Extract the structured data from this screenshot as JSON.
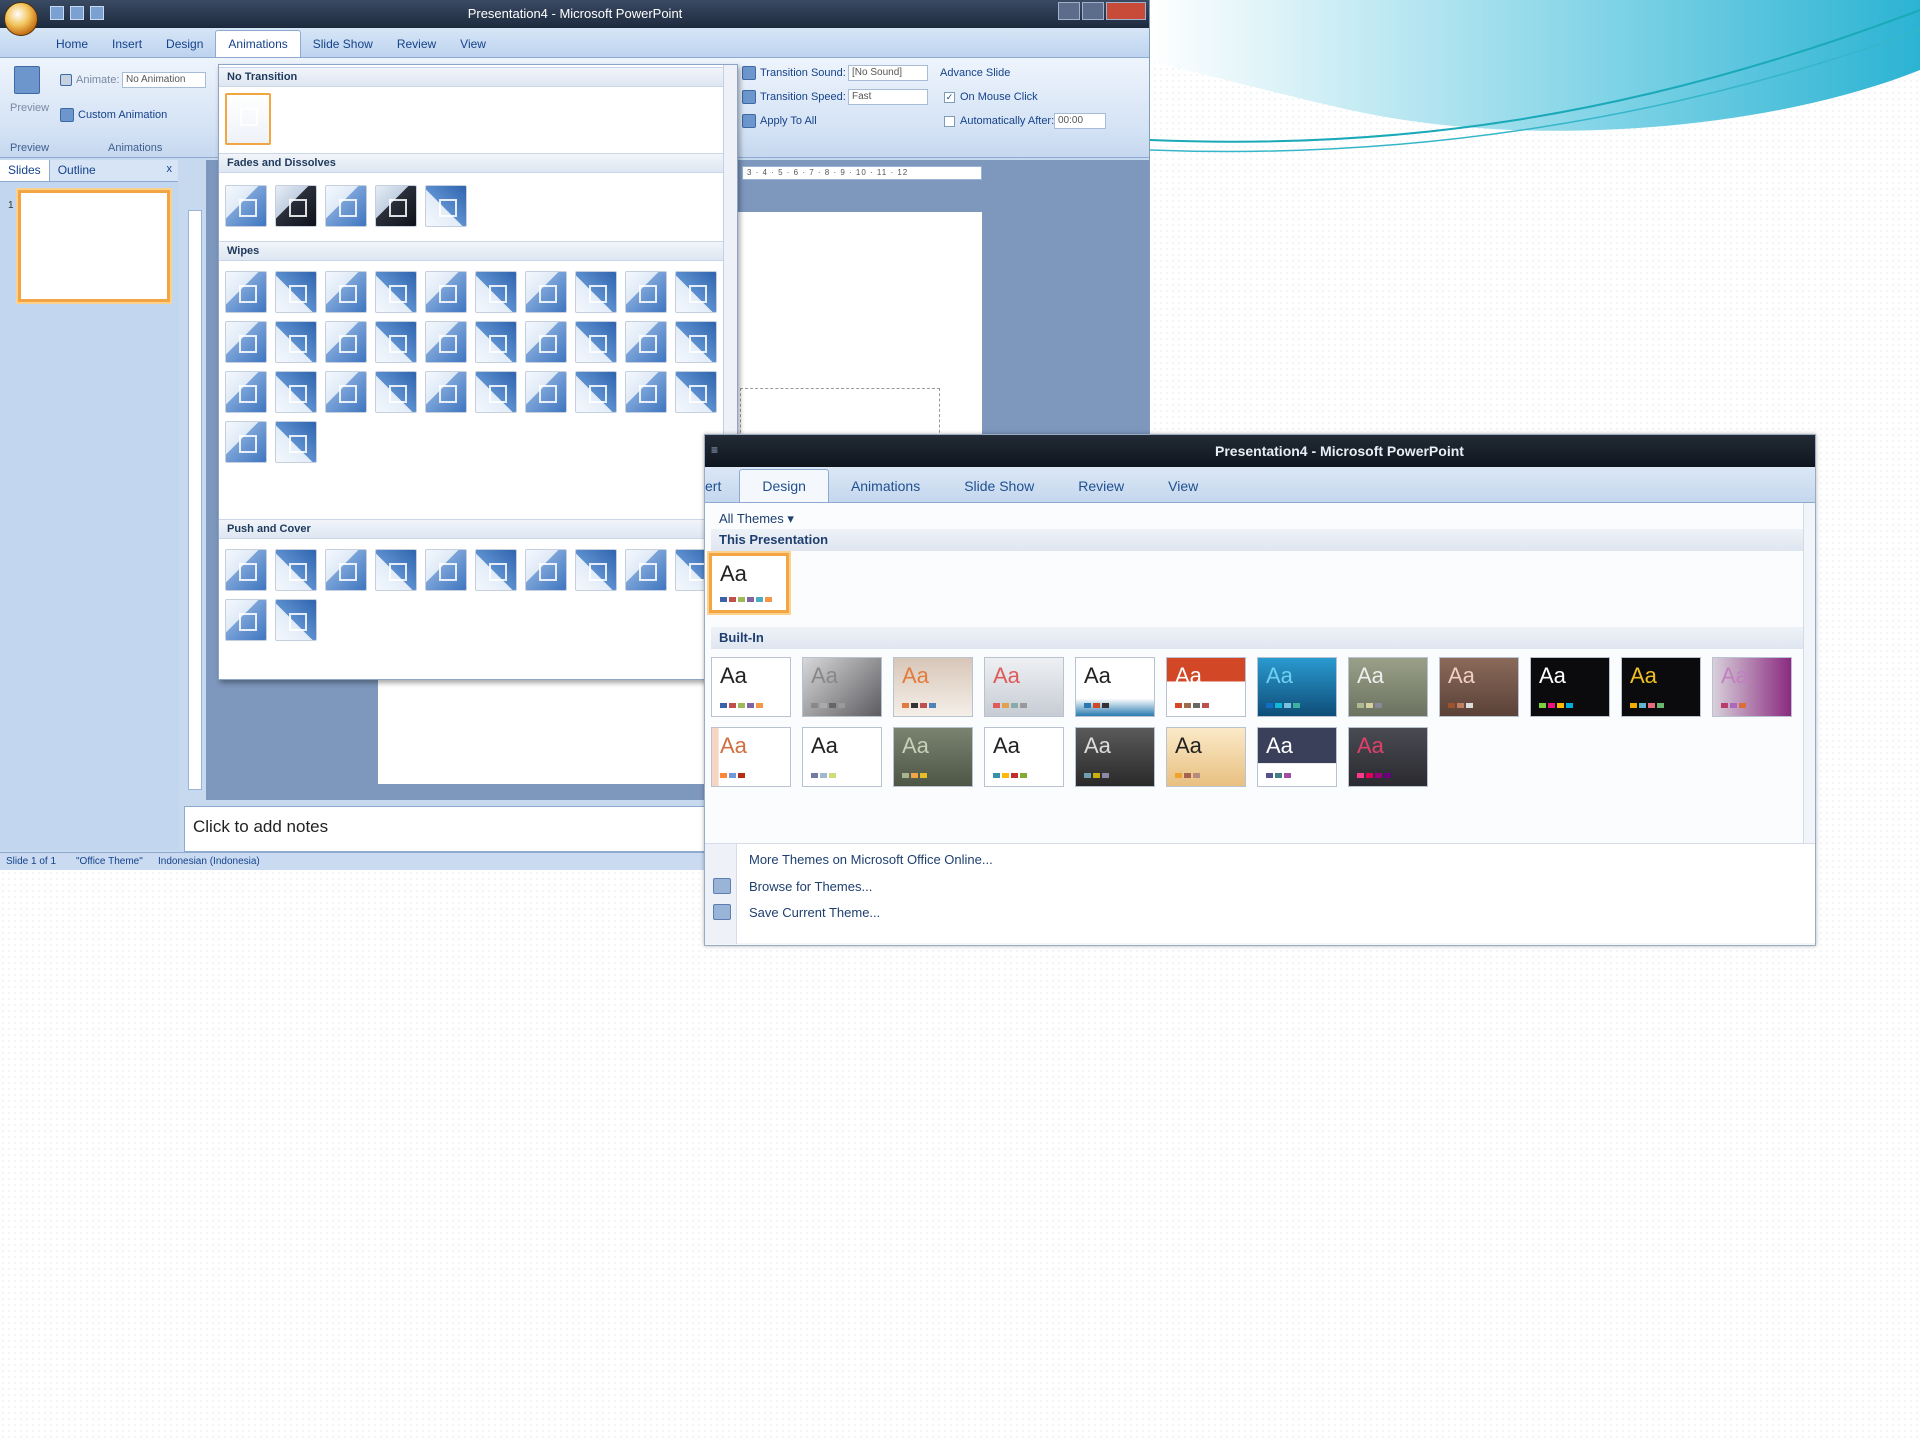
{
  "window1": {
    "title": "Presentation4 - Microsoft PowerPoint",
    "tabs": [
      "Home",
      "Insert",
      "Design",
      "Animations",
      "Slide Show",
      "Review",
      "View"
    ],
    "active_tab": "Animations",
    "ribbon": {
      "preview_label": "Preview",
      "animate_label": "Animate:",
      "animate_value": "No Animation",
      "custom_animation": "Custom Animation",
      "animations_group": "Animations",
      "transition_sound_label": "Transition Sound:",
      "transition_sound_value": "[No Sound]",
      "transition_speed_label": "Transition Speed:",
      "transition_speed_value": "Fast",
      "apply_to_all": "Apply To All",
      "advance_slide": "Advance Slide",
      "on_mouse_click": "On Mouse Click",
      "auto_after": "Automatically After:",
      "auto_after_value": "00:00"
    },
    "left_pane": {
      "tabs": [
        "Slides",
        "Outline"
      ],
      "close": "x",
      "slide_number": "1"
    },
    "ruler_text": "3 · 4 · 5 · 6 · 7 · 8 · 9 · 10 · 11 · 12",
    "notes_placeholder": "Click to add notes",
    "status": {
      "slide": "Slide 1 of 1",
      "theme": "\"Office Theme\"",
      "language": "Indonesian (Indonesia)"
    },
    "gallery": {
      "sections": [
        "No Transition",
        "Fades and Dissolves",
        "Wipes",
        "Push and Cover"
      ]
    }
  },
  "window2": {
    "title": "Presentation4 - Microsoft PowerPoint",
    "tabs": [
      "ert",
      "Design",
      "Animations",
      "Slide Show",
      "Review",
      "View"
    ],
    "active_tab": "Design",
    "all_themes": "All Themes ▾",
    "this_presentation": "This Presentation",
    "built_in": "Built-In",
    "theme_sample": "Aa",
    "links": [
      "More Themes on Microsoft Office Online...",
      "Browse for Themes...",
      "Save Current Theme..."
    ]
  },
  "colors": {
    "accent_orange": "#f3a443",
    "ribbon_blue": "#c7d9ef",
    "link_blue": "#1f3f6f"
  }
}
